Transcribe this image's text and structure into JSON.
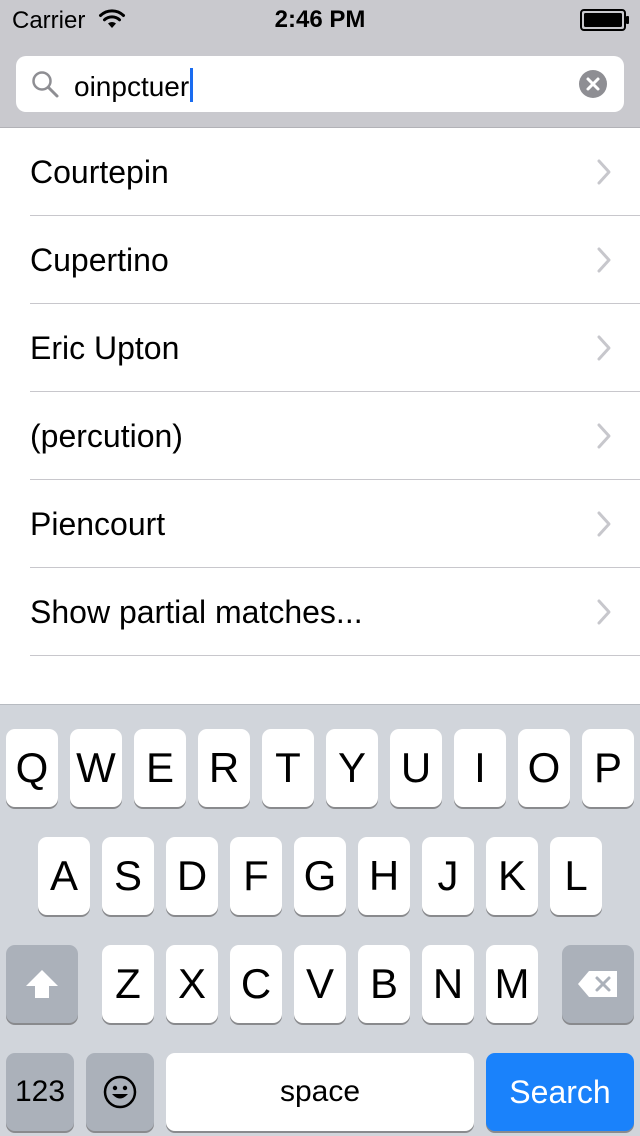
{
  "status_bar": {
    "carrier": "Carrier",
    "time": "2:46 PM"
  },
  "search": {
    "value": "oinpctuer"
  },
  "results": [
    {
      "label": "Courtepin"
    },
    {
      "label": "Cupertino"
    },
    {
      "label": "Eric Upton"
    },
    {
      "label": "(percution)"
    },
    {
      "label": "Piencourt"
    },
    {
      "label": "Show partial matches..."
    }
  ],
  "keyboard": {
    "row1": [
      "Q",
      "W",
      "E",
      "R",
      "T",
      "Y",
      "U",
      "I",
      "O",
      "P"
    ],
    "row2": [
      "A",
      "S",
      "D",
      "F",
      "G",
      "H",
      "J",
      "K",
      "L"
    ],
    "row3": [
      "Z",
      "X",
      "C",
      "V",
      "B",
      "N",
      "M"
    ],
    "numbers_label": "123",
    "space_label": "space",
    "search_label": "Search"
  },
  "colors": {
    "accent": "#1a82fb",
    "caret": "#1a6cf0",
    "header_bg": "#c9c9ce",
    "keyboard_bg": "#d1d5db"
  },
  "icons": [
    "wifi-icon",
    "battery-icon",
    "search-icon",
    "clear-icon",
    "chevron-icon",
    "shift-icon",
    "delete-icon",
    "emoji-icon"
  ]
}
